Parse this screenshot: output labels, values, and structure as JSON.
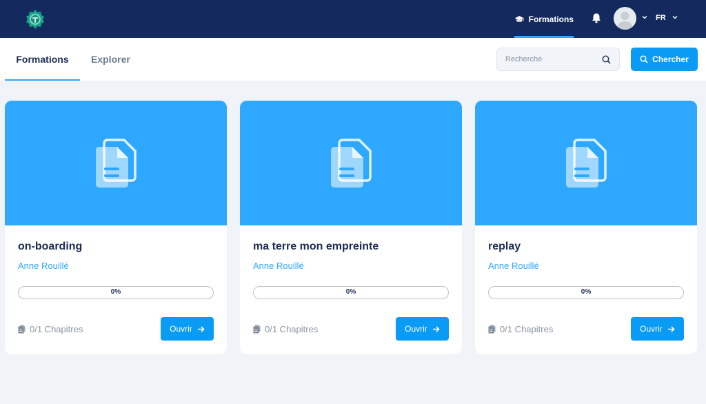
{
  "header": {
    "logo_icon": "compass-seal-icon",
    "nav_label": "Formations",
    "nav_icon": "graduation-cap-icon",
    "bell_icon": "bell-icon",
    "language": "FR"
  },
  "subnav": {
    "tabs": [
      {
        "label": "Formations",
        "active": true
      },
      {
        "label": "Explorer",
        "active": false
      }
    ],
    "search_placeholder": "Recherche",
    "search_button": "Chercher"
  },
  "colors": {
    "navbar": "#142a5e",
    "accent": "#2ea7ff",
    "button": "#0a9cf5",
    "background": "#f0f3f7"
  },
  "cards": [
    {
      "title": "on-boarding",
      "author": "Anne Rouillé",
      "progress": 0,
      "progress_label": "0%",
      "chapters": "0/1 Chapitres",
      "button": "Ouvrir"
    },
    {
      "title": "ma terre mon empreinte",
      "author": "Anne Rouillé",
      "progress": 0,
      "progress_label": "0%",
      "chapters": "0/1 Chapitres",
      "button": "Ouvrir"
    },
    {
      "title": "replay",
      "author": "Anne Rouillé",
      "progress": 0,
      "progress_label": "0%",
      "chapters": "0/1 Chapitres",
      "button": "Ouvrir"
    }
  ]
}
